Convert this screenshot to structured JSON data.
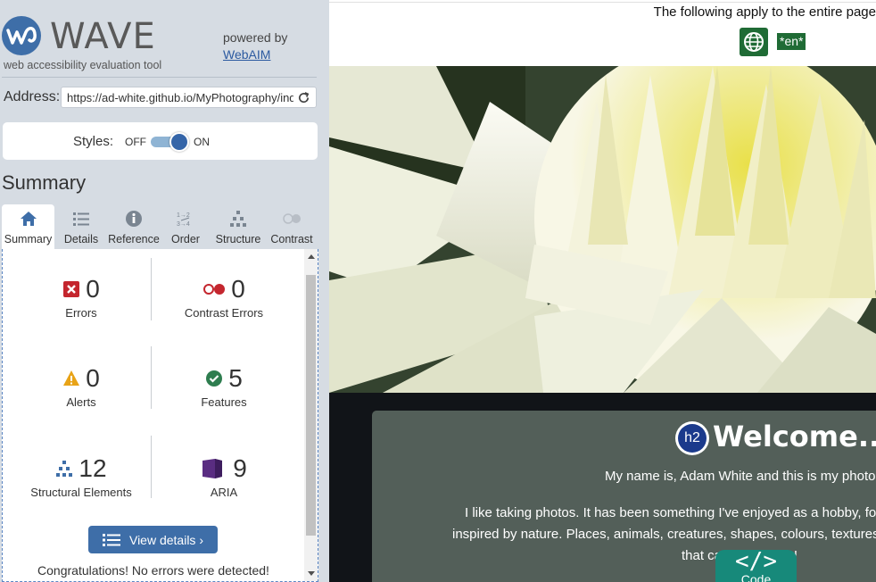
{
  "wave": {
    "title": "WAVE",
    "subtitle": "web accessibility evaluation tool",
    "powered_by": "powered by",
    "powered_by_link": "WebAIM",
    "address_label": "Address:",
    "address_value": "https://ad-white.github.io/MyPhotography/index.html",
    "styles_label": "Styles:",
    "styles_off": "OFF",
    "styles_on": "ON",
    "styles_state": "on",
    "summary_heading": "Summary",
    "tabs": [
      {
        "label": "Summary",
        "icon": "home-icon",
        "active": true
      },
      {
        "label": "Details",
        "icon": "list-icon",
        "active": false
      },
      {
        "label": "Reference",
        "icon": "info-icon",
        "active": false
      },
      {
        "label": "Order",
        "icon": "order-icon",
        "active": false
      },
      {
        "label": "Structure",
        "icon": "hierarchy-icon",
        "active": false
      },
      {
        "label": "Contrast",
        "icon": "contrast-icon",
        "active": false
      }
    ],
    "stats": [
      {
        "label": "Errors",
        "count": "0",
        "icon": "error-icon",
        "color": "#c4262e"
      },
      {
        "label": "Contrast Errors",
        "count": "0",
        "icon": "contrast-error-icon",
        "color": "#c4262e"
      },
      {
        "label": "Alerts",
        "count": "0",
        "icon": "alert-icon",
        "color": "#e8a317"
      },
      {
        "label": "Features",
        "count": "5",
        "icon": "feature-icon",
        "color": "#2e7d4f"
      },
      {
        "label": "Structural Elements",
        "count": "12",
        "icon": "structure-icon",
        "color": "#3e6ea8"
      },
      {
        "label": "ARIA",
        "count": "9",
        "icon": "aria-icon",
        "color": "#5a2d82"
      }
    ],
    "view_details": "View details ›",
    "congrats": "Congratulations! No errors were detected!"
  },
  "page": {
    "entire_page_notice": "The following apply to the entire page",
    "language_badge": "*en*",
    "h2_badge": "h2",
    "welcome": "Welcome...",
    "para_1": "My name is, Adam White and this is my photo",
    "para_2a": "I like taking photos. It has been something I've enjoyed as a hobby, for",
    "para_2b": "inspired by nature. Places, animals, creatures, shapes, colours, textures, w",
    "para_2c": "that capt        eye really!",
    "code_tab_icon": "</>",
    "code_tab_label": "Code"
  },
  "colors": {
    "wave_blue": "#3e6ea8",
    "sidebar_bg": "#d6dce3",
    "card_bg": "#535f59",
    "code_tab": "#17897a",
    "lang_green": "#1f6b35"
  }
}
